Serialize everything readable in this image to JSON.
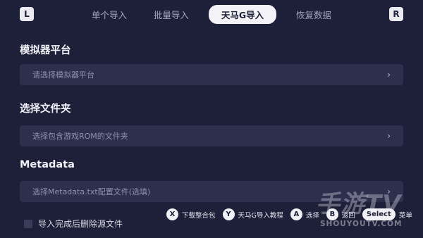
{
  "shoulders": {
    "left": "L",
    "right": "R"
  },
  "tabs": [
    {
      "label": "单个导入"
    },
    {
      "label": "批量导入"
    },
    {
      "label": "天马G导入"
    },
    {
      "label": "恢复数据"
    }
  ],
  "active_tab_index": 2,
  "sections": [
    {
      "title": "模拟器平台",
      "placeholder": "请选择模拟器平台"
    },
    {
      "title": "选择文件夹",
      "placeholder": "选择包含游戏ROM的文件夹"
    },
    {
      "title": "Metadata",
      "placeholder": "选择Metadata.txt配置文件(选填)"
    }
  ],
  "chevron": "›",
  "checkbox": {
    "label": "导入完成后删除源文件",
    "checked": false
  },
  "hints": [
    {
      "key": "X",
      "label": "下载整合包"
    },
    {
      "key": "Y",
      "label": "天马G导入教程"
    },
    {
      "key": "A",
      "label": "选择"
    },
    {
      "key": "B",
      "label": "返回"
    },
    {
      "key": "Select",
      "label": "菜单"
    }
  ],
  "watermark": {
    "main": "手游TV",
    "sub": "SHOUYOUTV.COM"
  },
  "colors": {
    "background": "#1e1f38",
    "field": "#2d2f4c",
    "active_tab": "#f3f3f7"
  }
}
